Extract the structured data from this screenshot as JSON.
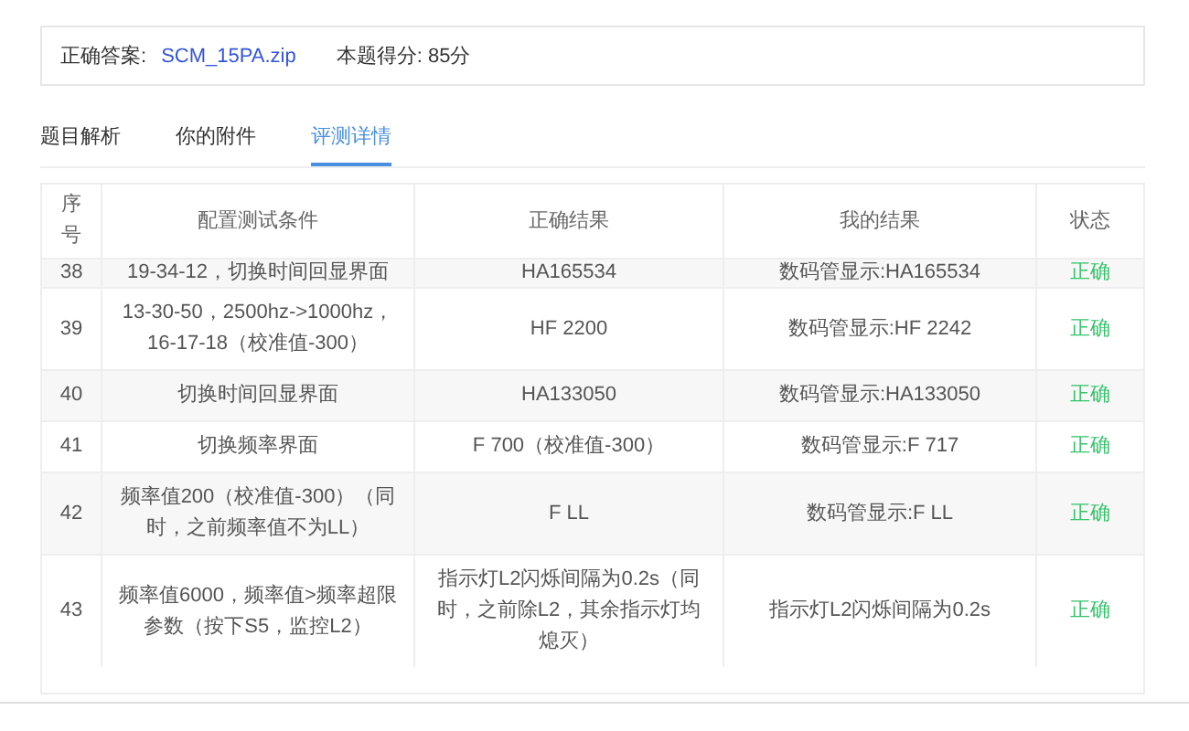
{
  "answer_card": {
    "label": "正确答案:",
    "file": "SCM_15PA.zip",
    "score": "本题得分: 85分"
  },
  "tabs": [
    {
      "label": "题目解析",
      "selected": false
    },
    {
      "label": "你的附件",
      "selected": false
    },
    {
      "label": "评测详情",
      "selected": true
    }
  ],
  "table": {
    "columns": [
      "序号",
      "配置测试条件",
      "正确结果",
      "我的结果",
      "状态"
    ],
    "rows": [
      {
        "cells": [
          "38",
          "19-34-12，切换时间回显界面",
          "HA165534",
          "数码管显示:HA165534",
          "正确"
        ],
        "color": "#35c46a"
      },
      {
        "cells": [
          "39",
          "13-30-50，2500hz->1000hz，16-17-18（校准值-300）",
          "HF 2200",
          "数码管显示:HF 2242",
          "正确"
        ],
        "color": "#35c46a"
      },
      {
        "cells": [
          "40",
          "切换时间回显界面",
          "HA133050",
          "数码管显示:HA133050",
          "正确"
        ],
        "color": "#35c46a"
      },
      {
        "cells": [
          "41",
          "切换频率界面",
          "F 700（校准值-300）",
          "数码管显示:F 717",
          "正确"
        ],
        "color": "#35c46a"
      },
      {
        "cells": [
          "42",
          "频率值200（校准值-300）（同时，之前频率值不为LL）",
          "F LL",
          "数码管显示:F LL",
          "正确"
        ],
        "color": "#35c46a"
      },
      {
        "cells": [
          "43",
          "频率值6000，频率值>频率超限参数（按下S5，监控L2）",
          "指示灯L2闪烁间隔为0.2s（同时，之前除L2，其余指示灯均熄灭）",
          "指示灯L2闪烁间隔为0.2s",
          "正确"
        ],
        "color": "#35c46a"
      }
    ]
  }
}
